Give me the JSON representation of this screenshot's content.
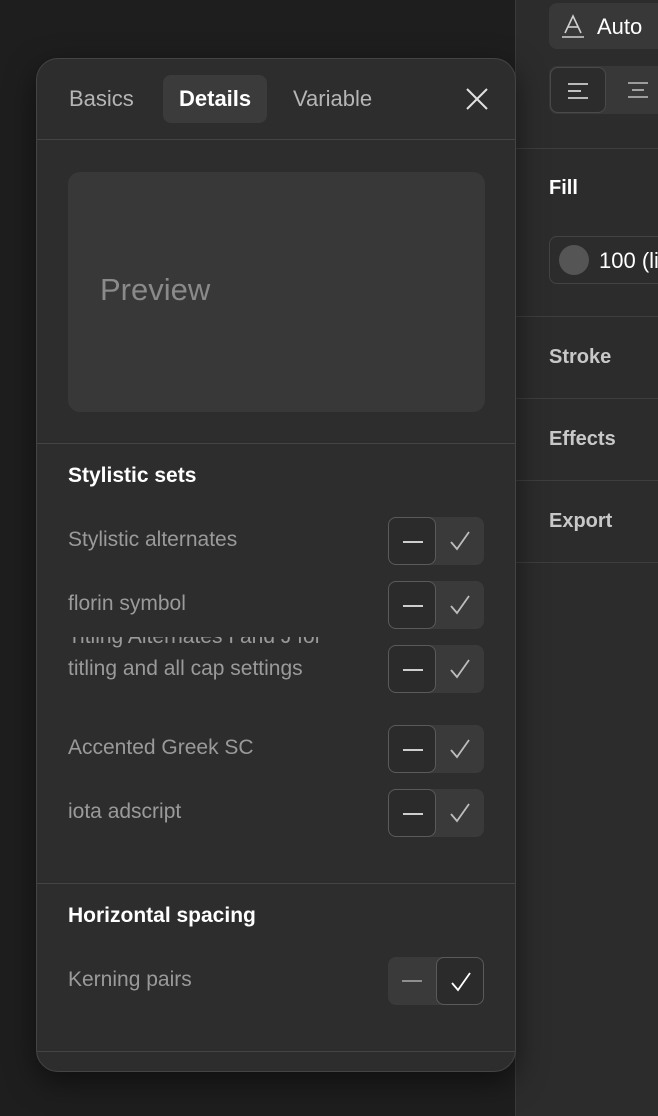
{
  "right_panel": {
    "auto_label": "Auto",
    "fill_heading": "Fill",
    "fill_value": "100 (li",
    "stroke_heading": "Stroke",
    "effects_heading": "Effects",
    "export_heading": "Export"
  },
  "modal": {
    "tabs": [
      {
        "label": "Basics",
        "active": false
      },
      {
        "label": "Details",
        "active": true
      },
      {
        "label": "Variable",
        "active": false
      }
    ],
    "preview_text": "Preview",
    "sections": [
      {
        "title": "Stylistic sets",
        "rows": [
          {
            "label": "Stylistic alternates",
            "state": "off"
          },
          {
            "label": "florin symbol",
            "state": "off"
          },
          {
            "label": "Titling Alternates I and J for titling and all cap settings",
            "state": "off"
          },
          {
            "label": "Accented Greek SC",
            "state": "off"
          },
          {
            "label": "iota adscript",
            "state": "off"
          }
        ]
      },
      {
        "title": "Horizontal spacing",
        "rows": [
          {
            "label": "Kerning pairs",
            "state": "on"
          }
        ]
      }
    ]
  },
  "icons": {
    "text_auto": "text-auto-icon",
    "align_left": "align-left-icon",
    "align_center": "align-center-icon",
    "close": "close-icon",
    "dash": "dash-icon",
    "check": "check-icon"
  },
  "colors": {
    "background": "#1e1e1e",
    "panel": "#2c2c2c",
    "modal": "#2d2d2d",
    "preview": "#383838",
    "muted_text": "#9a9a9a"
  }
}
